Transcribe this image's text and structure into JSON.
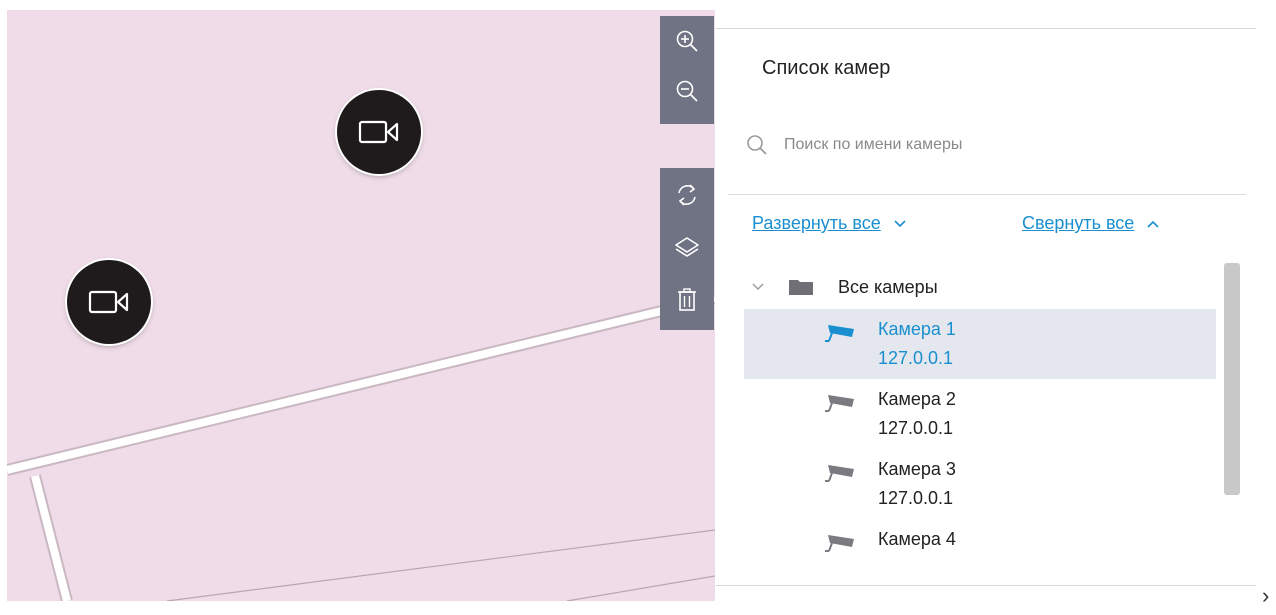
{
  "map": {
    "background_color": "#efdce8",
    "markers": [
      {
        "name": "camera-marker",
        "icon": "video-camera-icon"
      },
      {
        "name": "camera-marker",
        "icon": "video-camera-icon"
      }
    ]
  },
  "toolbar": {
    "color": "#6f7384",
    "zoom_group": [
      "zoom-in-icon",
      "zoom-out-icon"
    ],
    "tools_group": [
      "refresh-icon",
      "layers-icon",
      "trash-icon"
    ]
  },
  "panel": {
    "title": "Список камер",
    "search": {
      "placeholder": "Поиск по имени камеры",
      "value": ""
    },
    "expand_all_label": "Развернуть все",
    "collapse_all_label": "Свернуть все",
    "link_color": "#1a8fd0",
    "tree": {
      "folder_label": "Все камеры",
      "cameras": [
        {
          "name": "Камера 1",
          "address": "127.0.0.1",
          "selected": true
        },
        {
          "name": "Камера 2",
          "address": "127.0.0.1",
          "selected": false
        },
        {
          "name": "Камера 3",
          "address": "127.0.0.1",
          "selected": false
        },
        {
          "name": "Камера 4",
          "address": "",
          "selected": false
        }
      ]
    }
  }
}
